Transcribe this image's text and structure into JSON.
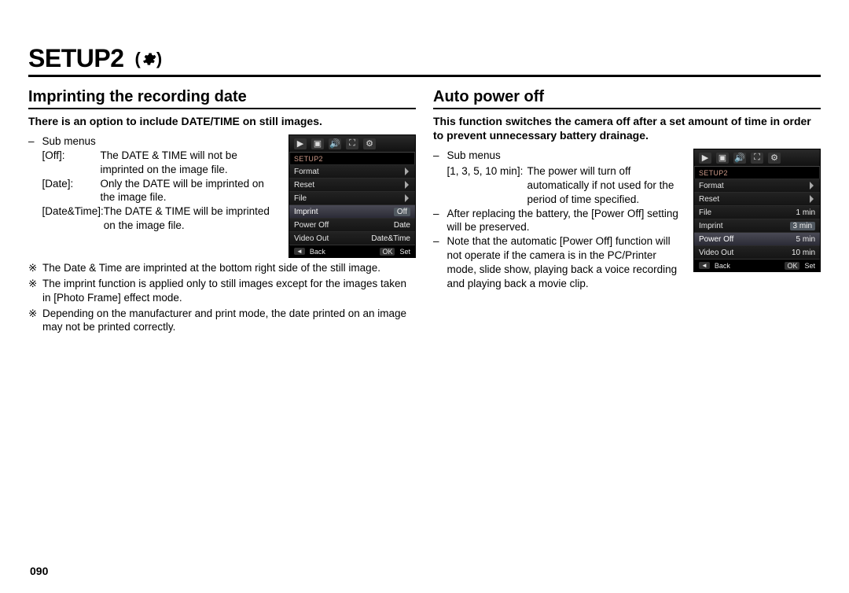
{
  "page_number": "090",
  "title": "SETUP2",
  "title_icon_name": "gear-icon",
  "title_icon_glyph": "(      )",
  "left": {
    "heading": "Imprinting the recording date",
    "intro": "There is an option to include DATE/TIME on still images.",
    "submenus_label": "Sub menus",
    "definitions": [
      {
        "term": "[Off]:",
        "desc": "The DATE & TIME will not be imprinted on the image file."
      },
      {
        "term": "[Date]:",
        "desc": "Only the DATE will be imprinted on the image file."
      },
      {
        "term": "[Date&Time]:",
        "desc": "The DATE & TIME will be imprinted on the image file."
      }
    ],
    "notes": [
      "The Date & Time are imprinted at the bottom right side of the still image.",
      "The imprint function is applied only to still images except for the images taken in [Photo Frame] effect mode.",
      "Depending on the manufacturer and print mode, the date printed on an image may not be printed correctly."
    ],
    "lcd": {
      "crumb": "SETUP2",
      "rows": [
        {
          "label": "Format",
          "value": "",
          "chevron": true,
          "selected": false
        },
        {
          "label": "Reset",
          "value": "",
          "chevron": true,
          "selected": false
        },
        {
          "label": "File",
          "value": "",
          "chevron": true,
          "selected": false
        },
        {
          "label": "Imprint",
          "value": "Off",
          "chevron": false,
          "selected": true,
          "value_selected": true
        },
        {
          "label": "Power Off",
          "value": "Date",
          "chevron": false,
          "selected": false
        },
        {
          "label": "Video Out",
          "value": "Date&Time",
          "chevron": false,
          "selected": false
        }
      ],
      "footer": {
        "back_key": "◄",
        "back_label": "Back",
        "ok_key": "OK",
        "ok_label": "Set"
      },
      "top_icons": [
        "play",
        "square",
        "sound",
        "setup1",
        "setup2"
      ]
    }
  },
  "right": {
    "heading": "Auto power off",
    "intro": "This function switches the camera off after a set amount of time in order to prevent unnecessary battery drainage.",
    "submenus_label": "Sub menus",
    "options_line_term": "[1, 3, 5, 10 min]:",
    "options_line_desc": "The power will turn off automatically if not used for the period of time specified.",
    "bullets": [
      "After replacing the battery, the [Power Off] setting will be preserved.",
      "Note that the automatic [Power Off] function will not operate if the camera is in the PC/Printer mode, slide show, playing back a voice recording and playing back a movie clip."
    ],
    "lcd": {
      "crumb": "SETUP2",
      "rows": [
        {
          "label": "Format",
          "value": "",
          "chevron": true,
          "selected": false
        },
        {
          "label": "Reset",
          "value": "",
          "chevron": true,
          "selected": false
        },
        {
          "label": "File",
          "value": "1 min",
          "chevron": false,
          "selected": false
        },
        {
          "label": "Imprint",
          "value": "3 min",
          "chevron": false,
          "selected": false,
          "value_selected": true
        },
        {
          "label": "Power Off",
          "value": "5 min",
          "chevron": false,
          "selected": true
        },
        {
          "label": "Video Out",
          "value": "10 min",
          "chevron": false,
          "selected": false
        }
      ],
      "footer": {
        "back_key": "◄",
        "back_label": "Back",
        "ok_key": "OK",
        "ok_label": "Set"
      },
      "top_icons": [
        "play",
        "square",
        "sound",
        "setup1",
        "setup2"
      ]
    }
  }
}
